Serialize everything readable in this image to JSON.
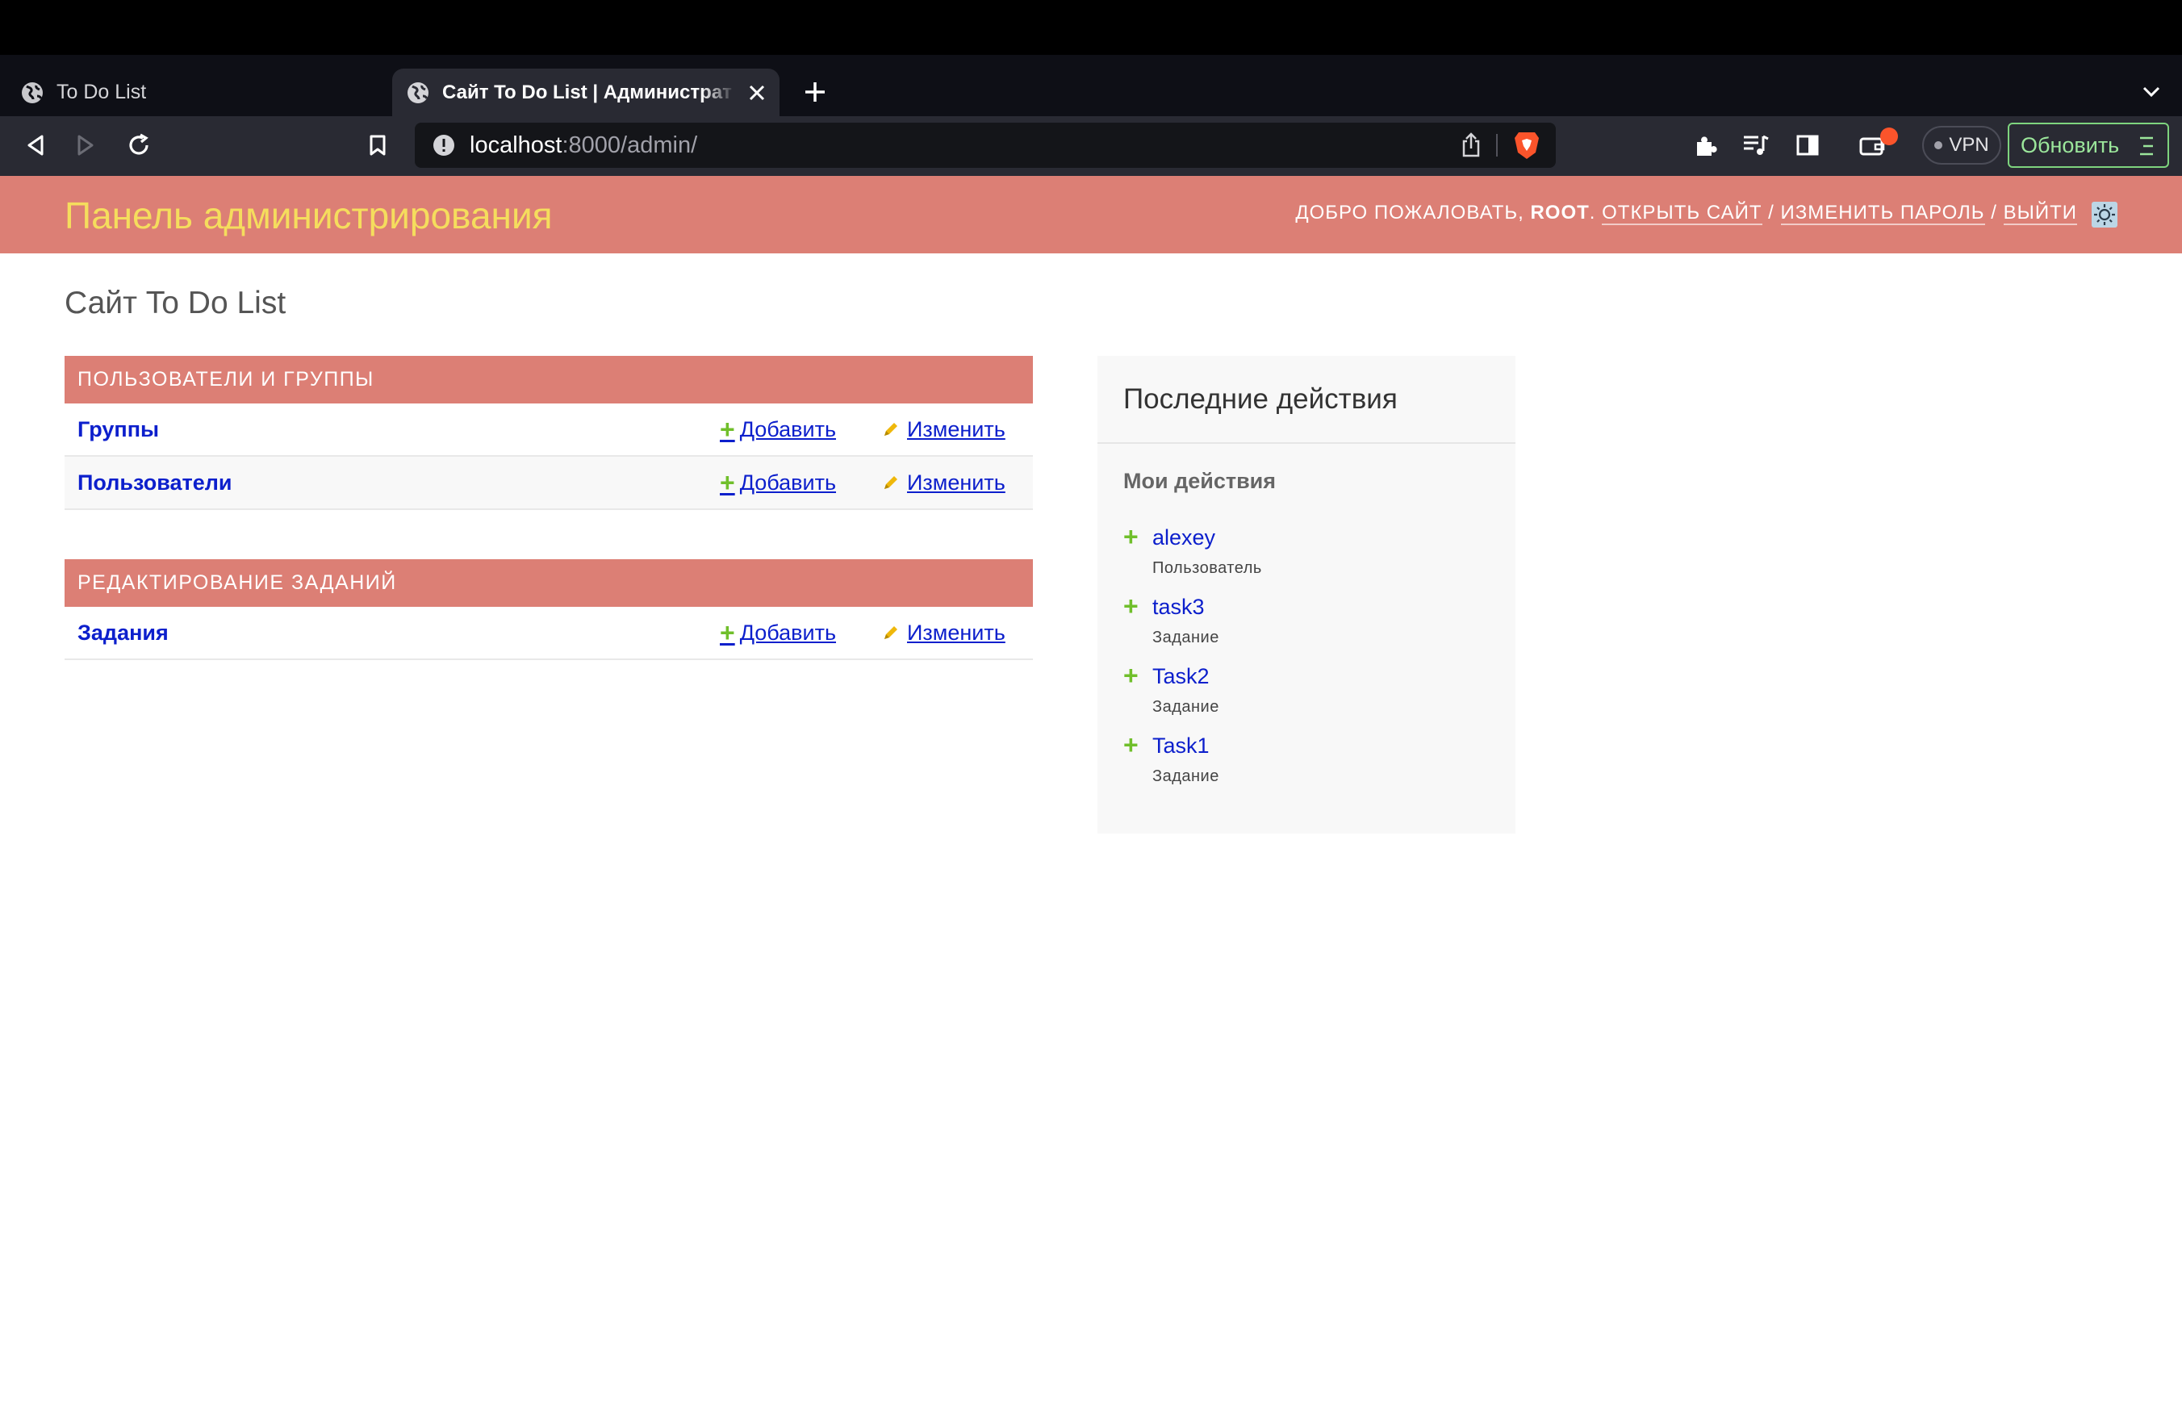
{
  "browser": {
    "tabs": [
      {
        "title": "To Do List",
        "active": false
      },
      {
        "title": "Сайт To Do List | Администрат",
        "active": true
      }
    ],
    "url_host": "localhost",
    "url_rest": ":8000/admin/",
    "vpn_label": "VPN",
    "update_label": "Обновить",
    "accent_update": "#7ed47e"
  },
  "header": {
    "brand": "Панель администрирования",
    "welcome": "Добро пожаловать, ",
    "username": "root",
    "after_user": ". ",
    "view_site": "Открыть сайт",
    "change_password": "Изменить пароль",
    "logout": "Выйти",
    "slash": " / ",
    "colors": {
      "header_bg": "#dc7f75",
      "brand": "#f5dd5d"
    }
  },
  "content": {
    "title": "Сайт To Do List",
    "modules": [
      {
        "caption": "Пользователи и группы",
        "rows": [
          {
            "model": "Группы",
            "add": "Добавить",
            "change": "Изменить"
          },
          {
            "model": "Пользователи",
            "add": "Добавить",
            "change": "Изменить"
          }
        ]
      },
      {
        "caption": "Редактирование заданий",
        "rows": [
          {
            "model": "Задания",
            "add": "Добавить",
            "change": "Изменить"
          }
        ]
      }
    ]
  },
  "recent_actions": {
    "title": "Последние действия",
    "subtitle": "Мои действия",
    "items": [
      {
        "name": "alexey",
        "type": "Пользователь",
        "icon": "addlink-icon"
      },
      {
        "name": "task3",
        "type": "Задание",
        "icon": "addlink-icon"
      },
      {
        "name": "Task2",
        "type": "Задание",
        "icon": "addlink-icon"
      },
      {
        "name": "Task1",
        "type": "Задание",
        "icon": "addlink-icon"
      }
    ]
  }
}
